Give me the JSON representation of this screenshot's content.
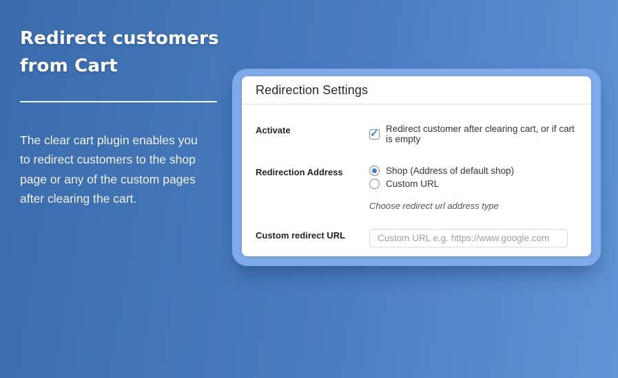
{
  "page": {
    "background_gradient": [
      "#3a6cad",
      "#6094d5"
    ]
  },
  "hero": {
    "title_line1": "Redirect customers",
    "title_line2": "from Cart",
    "description": "The clear cart plugin enables you to redirect customers to the shop page or any of the custom pages after clearing the cart."
  },
  "panel": {
    "frame_color": "#7fabea",
    "title": "Redirection Settings",
    "accent_color": "#3582c4",
    "rows": {
      "activate": {
        "label": "Activate",
        "checkbox_checked": true,
        "checkbox_label": "Redirect customer after clearing cart, or if cart is empty"
      },
      "redirection_address": {
        "label": "Redirection Address",
        "options": [
          {
            "label": "Shop (Address of default shop)",
            "selected": true
          },
          {
            "label": "Custom URL",
            "selected": false
          }
        ],
        "hint": "Choose redirect url address type"
      },
      "custom_redirect_url": {
        "label": "Custom redirect URL",
        "input_value": "",
        "input_placeholder": "Custom URL e.g. https://www.google.com"
      }
    }
  }
}
